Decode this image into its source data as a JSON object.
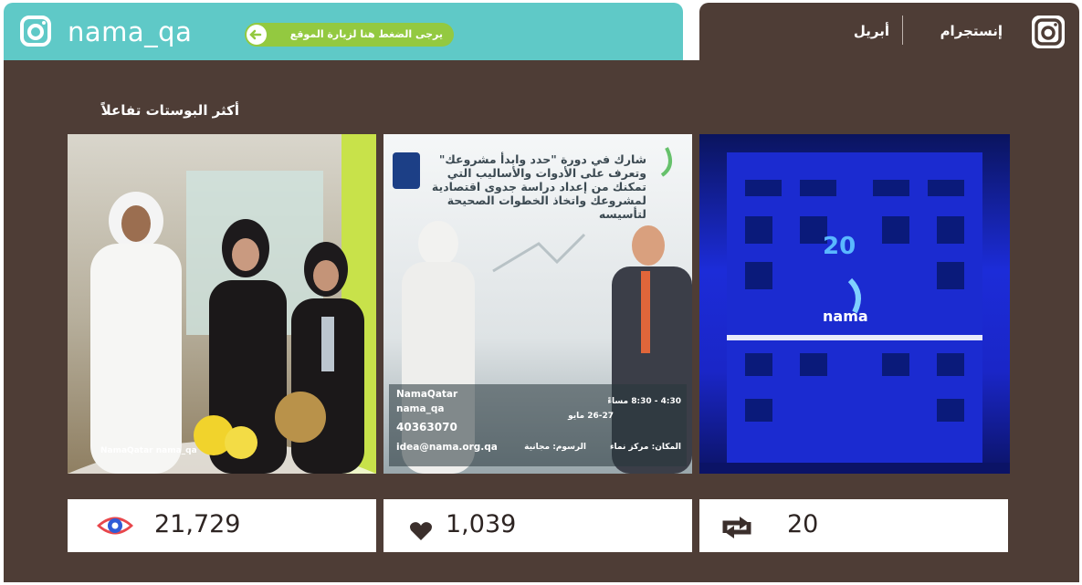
{
  "header": {
    "handle": "nama_qa",
    "visit_label": "يرجى الضغط هنا لزيارة الموقع",
    "platform": "إنستجرام",
    "month": "أبريل"
  },
  "section": {
    "title": "أكثر البوستات تفاعلاً"
  },
  "posts": [
    {
      "footer": "NamaQatar  nama_qa"
    },
    {
      "headline": "شارك في دورة \"حدد وابدأ مشروعك\" وتعرف على الأدوات والأساليب التي تمكنك من إعداد دراسة جدوى اقتصادية لمشروعك واتخاذ الخطوات الصحيحة لتأسيسه",
      "social": "NamaQatar",
      "social2": "nama_qa",
      "phone": "40363070",
      "email": "idea@nama.org.qa",
      "place": "المكان: مركز نماء",
      "fees": "الرسوم: مجانية",
      "date": "26-27 مايو",
      "time": "4:30 - 8:30 مساءً"
    },
    {
      "number": "20",
      "brand": "nama"
    }
  ],
  "stats": {
    "views": "21,729",
    "likes": "1,039",
    "reposts": "20"
  },
  "colors": {
    "teal": "#5fc9c7",
    "brown": "#4e3d36",
    "green": "#93c940"
  }
}
